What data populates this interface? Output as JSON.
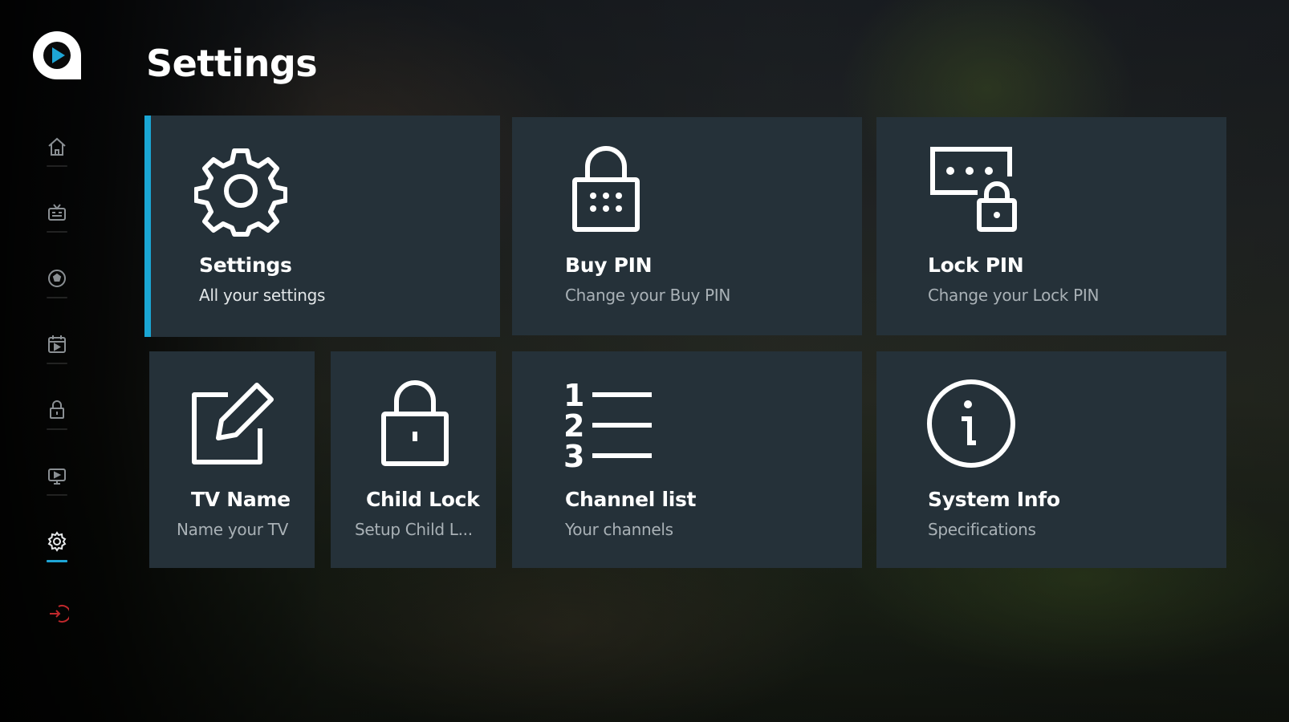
{
  "page": {
    "title": "Settings"
  },
  "sidebar": {
    "logo_icon": "app-logo-play-icon",
    "items": [
      {
        "icon": "home-icon",
        "active": false
      },
      {
        "icon": "tv-channels-icon",
        "active": false
      },
      {
        "icon": "sports-ball-icon",
        "active": false
      },
      {
        "icon": "calendar-icon",
        "active": false
      },
      {
        "icon": "lock-icon",
        "active": false
      },
      {
        "icon": "tv-icon",
        "active": false
      },
      {
        "icon": "gear-icon",
        "active": true
      },
      {
        "icon": "logout-icon",
        "active": false
      }
    ],
    "active_color": "#1ea6d6",
    "logout_color": "#c0282c"
  },
  "tiles": {
    "settings": {
      "title": "Settings",
      "subtitle": "All your settings",
      "icon": "gear-icon"
    },
    "buy_pin": {
      "title": "Buy PIN",
      "subtitle": "Change your Buy PIN",
      "icon": "keypad-lock-icon"
    },
    "lock_pin": {
      "title": "Lock PIN",
      "subtitle": "Change your Lock PIN",
      "icon": "pin-lock-icon"
    },
    "tv_name": {
      "title": "TV Name",
      "subtitle": "Name your TV",
      "icon": "edit-icon"
    },
    "child_lock": {
      "title": "Child Lock",
      "subtitle": "Setup Child L...",
      "icon": "padlock-icon"
    },
    "channel_list": {
      "title": "Channel list",
      "subtitle": "Your channels",
      "icon": "numbered-list-icon"
    },
    "system_info": {
      "title": "System Info",
      "subtitle": "Specifications",
      "icon": "info-icon"
    }
  },
  "colors": {
    "tile_bg": "#253139",
    "focus_accent": "#1aa6d4"
  }
}
